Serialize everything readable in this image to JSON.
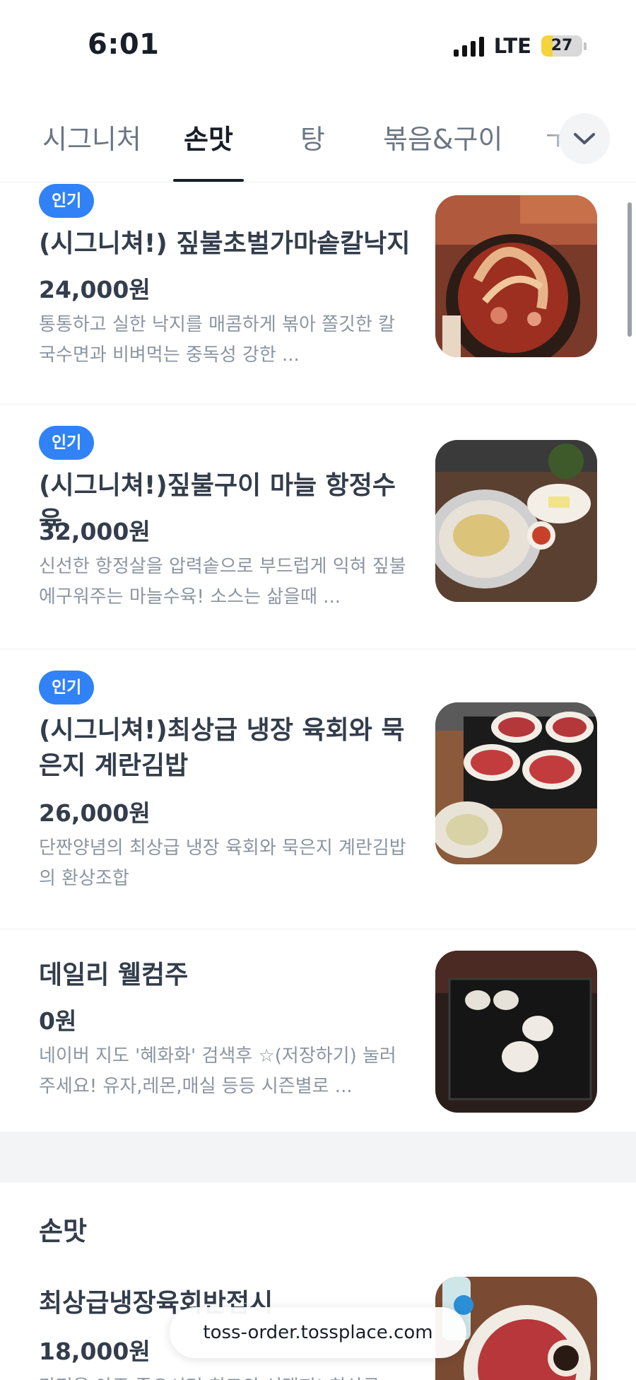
{
  "status_bar": {
    "time": "6:01",
    "network": "LTE",
    "battery": "27"
  },
  "tabs": [
    {
      "label": "시그니처",
      "active": false
    },
    {
      "label": "손맛",
      "active": true
    },
    {
      "label": "탕",
      "active": false
    },
    {
      "label": "볶음&구이",
      "active": false
    }
  ],
  "items": [
    {
      "badge": "인기",
      "name": "(시그니쳐!) 짚불초벌가마솥칼낙지",
      "price": "24,000원",
      "description": "통통하고 실한 낙지를 매콤하게 볶아 쫄깃한 칼국수면과 비벼먹는 중독성 강한 ..."
    },
    {
      "badge": "인기",
      "name": "(시그니쳐!)짚불구이 마늘 항정수육",
      "price": "32,000원",
      "description": "신선한  항정살을 압력솥으로 부드럽게 익혀 짚불에구워주는 마늘수육! 소스는 삶을때 ..."
    },
    {
      "badge": "인기",
      "name": "(시그니쳐!)최상급 냉장 육회와 묵은지 계란김밥",
      "price": "26,000원",
      "description": "단짠양념의 최상급 냉장 육회와 묵은지 계란김밥의 환상조합"
    },
    {
      "name": "데일리 웰컴주",
      "price": "0원",
      "description": "네이버 지도 '혜화화' 검색후 ☆(저장하기) 눌러주세요! 유자,레몬,매실 등등 시즌별로 ..."
    }
  ],
  "section": {
    "title": "손맛",
    "items": [
      {
        "name": "최상급냉장육회반접시",
        "price": "18,000원",
        "description": "간편을 아주 좋으시면 최고의 선택지! 최상급"
      }
    ]
  },
  "url_bar": {
    "url": "toss-order.tossplace.com"
  },
  "colors": {
    "accent": "#3182f6",
    "text_primary": "#333d4b",
    "text_secondary": "#8b95a1"
  }
}
